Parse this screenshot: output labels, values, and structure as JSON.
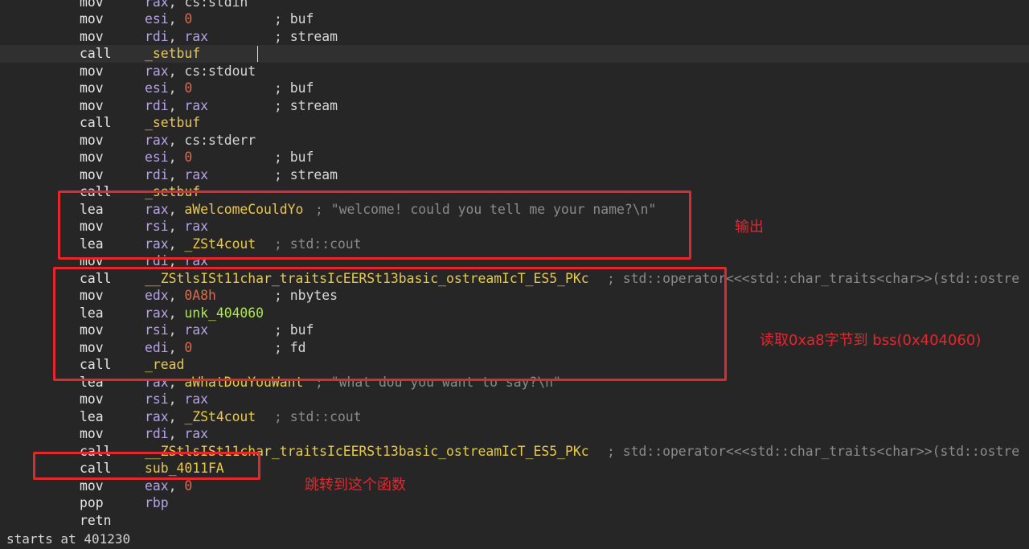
{
  "lines": [
    {
      "mn": "mov",
      "ops": [
        {
          "t": "rax",
          "k": "reg"
        },
        {
          "t": ", ",
          "k": "pn"
        },
        {
          "t": "cs:stdin",
          "k": "txt"
        }
      ]
    },
    {
      "mn": "mov",
      "ops": [
        {
          "t": "esi",
          "k": "reg"
        },
        {
          "t": ", ",
          "k": "pn"
        },
        {
          "t": "0",
          "k": "num"
        }
      ],
      "comment": [
        {
          "t": "; ",
          "k": "pn"
        },
        {
          "t": "buf",
          "k": "cmt-name"
        }
      ],
      "ccol": 341
    },
    {
      "mn": "mov",
      "ops": [
        {
          "t": "rdi",
          "k": "reg"
        },
        {
          "t": ", ",
          "k": "pn"
        },
        {
          "t": "rax",
          "k": "reg"
        }
      ],
      "comment": [
        {
          "t": "; ",
          "k": "pn"
        },
        {
          "t": "stream",
          "k": "cmt-name"
        }
      ],
      "ccol": 341
    },
    {
      "mn": "call",
      "ops": [
        {
          "t": "_setbuf",
          "k": "sym"
        }
      ]
    },
    {
      "mn": "mov",
      "ops": [
        {
          "t": "rax",
          "k": "reg"
        },
        {
          "t": ", ",
          "k": "pn"
        },
        {
          "t": "cs:stdout",
          "k": "txt"
        }
      ]
    },
    {
      "mn": "mov",
      "ops": [
        {
          "t": "esi",
          "k": "reg"
        },
        {
          "t": ", ",
          "k": "pn"
        },
        {
          "t": "0",
          "k": "num"
        }
      ],
      "comment": [
        {
          "t": "; ",
          "k": "pn"
        },
        {
          "t": "buf",
          "k": "cmt-name"
        }
      ],
      "ccol": 341
    },
    {
      "mn": "mov",
      "ops": [
        {
          "t": "rdi",
          "k": "reg"
        },
        {
          "t": ", ",
          "k": "pn"
        },
        {
          "t": "rax",
          "k": "reg"
        }
      ],
      "comment": [
        {
          "t": "; ",
          "k": "pn"
        },
        {
          "t": "stream",
          "k": "cmt-name"
        }
      ],
      "ccol": 341
    },
    {
      "mn": "call",
      "ops": [
        {
          "t": "_setbuf",
          "k": "sym"
        }
      ]
    },
    {
      "mn": "mov",
      "ops": [
        {
          "t": "rax",
          "k": "reg"
        },
        {
          "t": ", ",
          "k": "pn"
        },
        {
          "t": "cs:stderr",
          "k": "txt"
        }
      ]
    },
    {
      "mn": "mov",
      "ops": [
        {
          "t": "esi",
          "k": "reg"
        },
        {
          "t": ", ",
          "k": "pn"
        },
        {
          "t": "0",
          "k": "num"
        }
      ],
      "comment": [
        {
          "t": "; ",
          "k": "pn"
        },
        {
          "t": "buf",
          "k": "cmt-name"
        }
      ],
      "ccol": 341
    },
    {
      "mn": "mov",
      "ops": [
        {
          "t": "rdi",
          "k": "reg"
        },
        {
          "t": ", ",
          "k": "pn"
        },
        {
          "t": "rax",
          "k": "reg"
        }
      ],
      "comment": [
        {
          "t": "; ",
          "k": "pn"
        },
        {
          "t": "stream",
          "k": "cmt-name"
        }
      ],
      "ccol": 341
    },
    {
      "mn": "call",
      "ops": [
        {
          "t": "_setbuf",
          "k": "sym"
        }
      ]
    },
    {
      "mn": "lea",
      "ops": [
        {
          "t": "rax",
          "k": "reg"
        },
        {
          "t": ", ",
          "k": "pn"
        },
        {
          "t": "aWelcomeCouldYo",
          "k": "sym"
        }
      ],
      "comment": [
        {
          "t": "; \"welcome! could you tell me your name?\\n\"",
          "k": "cmt"
        }
      ],
      "ccol": 392
    },
    {
      "mn": "mov",
      "ops": [
        {
          "t": "rsi",
          "k": "reg"
        },
        {
          "t": ", ",
          "k": "pn"
        },
        {
          "t": "rax",
          "k": "reg"
        }
      ]
    },
    {
      "mn": "lea",
      "ops": [
        {
          "t": "rax",
          "k": "reg"
        },
        {
          "t": ", ",
          "k": "pn"
        },
        {
          "t": "_ZSt4cout",
          "k": "sym"
        }
      ],
      "comment": [
        {
          "t": "; std::cout",
          "k": "cmt"
        }
      ],
      "ccol": 341
    },
    {
      "mn": "mov",
      "ops": [
        {
          "t": "rdi",
          "k": "reg"
        },
        {
          "t": ", ",
          "k": "pn"
        },
        {
          "t": "rax",
          "k": "reg"
        }
      ]
    },
    {
      "mn": "call",
      "ops": [
        {
          "t": "__ZStlsISt11char_traitsIcEERSt13basic_ostreamIcT_ES5_PKc",
          "k": "sym"
        }
      ],
      "comment": [
        {
          "t": "; std::operator<<<std::char_traits<char>>(std::ostre",
          "k": "cmt"
        }
      ],
      "ccol": 755
    },
    {
      "mn": "mov",
      "ops": [
        {
          "t": "edx",
          "k": "reg"
        },
        {
          "t": ", ",
          "k": "pn"
        },
        {
          "t": "0A8h",
          "k": "num"
        }
      ],
      "comment": [
        {
          "t": "; ",
          "k": "pn"
        },
        {
          "t": "nbytes",
          "k": "cmt-name"
        }
      ],
      "ccol": 341
    },
    {
      "mn": "lea",
      "ops": [
        {
          "t": "rax",
          "k": "reg"
        },
        {
          "t": ", ",
          "k": "pn"
        },
        {
          "t": "unk_404060",
          "k": "lbl"
        }
      ]
    },
    {
      "mn": "mov",
      "ops": [
        {
          "t": "rsi",
          "k": "reg"
        },
        {
          "t": ", ",
          "k": "pn"
        },
        {
          "t": "rax",
          "k": "reg"
        }
      ],
      "comment": [
        {
          "t": "; ",
          "k": "pn"
        },
        {
          "t": "buf",
          "k": "cmt-name"
        }
      ],
      "ccol": 341
    },
    {
      "mn": "mov",
      "ops": [
        {
          "t": "edi",
          "k": "reg"
        },
        {
          "t": ", ",
          "k": "pn"
        },
        {
          "t": "0",
          "k": "num"
        }
      ],
      "comment": [
        {
          "t": "; ",
          "k": "pn"
        },
        {
          "t": "fd",
          "k": "cmt-name"
        }
      ],
      "ccol": 341
    },
    {
      "mn": "call",
      "ops": [
        {
          "t": "_read",
          "k": "sym"
        }
      ]
    },
    {
      "mn": "lea",
      "ops": [
        {
          "t": "rax",
          "k": "reg"
        },
        {
          "t": ", ",
          "k": "pn"
        },
        {
          "t": "aWhatDouYouWant",
          "k": "sym"
        }
      ],
      "comment": [
        {
          "t": "; \"what dou you want to say?\\n\"",
          "k": "cmt"
        }
      ],
      "ccol": 392
    },
    {
      "mn": "mov",
      "ops": [
        {
          "t": "rsi",
          "k": "reg"
        },
        {
          "t": ", ",
          "k": "pn"
        },
        {
          "t": "rax",
          "k": "reg"
        }
      ]
    },
    {
      "mn": "lea",
      "ops": [
        {
          "t": "rax",
          "k": "reg"
        },
        {
          "t": ", ",
          "k": "pn"
        },
        {
          "t": "_ZSt4cout",
          "k": "sym"
        }
      ],
      "comment": [
        {
          "t": "; std::cout",
          "k": "cmt"
        }
      ],
      "ccol": 341
    },
    {
      "mn": "mov",
      "ops": [
        {
          "t": "rdi",
          "k": "reg"
        },
        {
          "t": ", ",
          "k": "pn"
        },
        {
          "t": "rax",
          "k": "reg"
        }
      ]
    },
    {
      "mn": "call",
      "ops": [
        {
          "t": "__ZStlsISt11char_traitsIcEERSt13basic_ostreamIcT_ES5_PKc",
          "k": "sym"
        }
      ],
      "comment": [
        {
          "t": "; std::operator<<<std::char_traits<char>>(std::ostre",
          "k": "cmt"
        }
      ],
      "ccol": 755
    },
    {
      "mn": "call",
      "ops": [
        {
          "t": "sub_4011FA",
          "k": "sym"
        }
      ]
    },
    {
      "mn": "mov",
      "ops": [
        {
          "t": "eax",
          "k": "reg"
        },
        {
          "t": ", ",
          "k": "pn"
        },
        {
          "t": "0",
          "k": "num"
        }
      ]
    },
    {
      "mn": "pop",
      "ops": [
        {
          "t": "rbp",
          "k": "reg"
        }
      ]
    },
    {
      "mn": "retn",
      "ops": []
    }
  ],
  "highlighted_line": 3,
  "annotations": {
    "output": "输出",
    "read": "读取0xa8字节到 bss(0x404060)",
    "jump": "跳转到这个函数"
  },
  "status": {
    "text": "starts at 401230"
  },
  "colors": {
    "background": "#262626",
    "register": "#b6a3e8",
    "number": "#e2674a",
    "symbol": "#e8c94a",
    "label": "#aee84a",
    "comment": "#8a8a8a",
    "annotation": "#e5262c"
  }
}
